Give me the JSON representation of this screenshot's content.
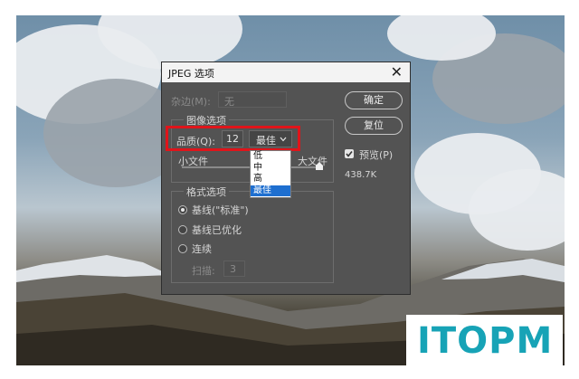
{
  "dialog": {
    "title": "JPEG 选项",
    "close_symbol": "✕",
    "matte_label": "杂边(M):",
    "matte_value": "无",
    "ok_label": "确定",
    "reset_label": "复位",
    "preview_label": "预览(P)",
    "preview_checked": true,
    "file_size": "438.7K",
    "image_options": {
      "legend": "图像选项",
      "quality_label": "品质(Q):",
      "quality_value": "12",
      "quality_preset": "最佳",
      "small_file": "小文件",
      "large_file": "大文件",
      "quality_level": 1.0,
      "dropdown_options": [
        "低",
        "中",
        "高",
        "最佳"
      ],
      "selected_option": "最佳"
    },
    "format_options": {
      "legend": "格式选项",
      "baseline_standard": "基线(\"标准\")",
      "baseline_optimized": "基线已优化",
      "progressive": "连续",
      "scans_label": "扫描:",
      "scans_value": "3"
    }
  },
  "watermark": {
    "text": "ITOPM"
  },
  "icons": [
    "close-icon",
    "checkbox-icon",
    "chevron-down-icon",
    "slider-thumb-icon"
  ],
  "colors": {
    "dialog_bg": "#535353",
    "highlight": "#e0141a",
    "selected_item": "#1e6fd0",
    "logo": "#17a3b6"
  }
}
